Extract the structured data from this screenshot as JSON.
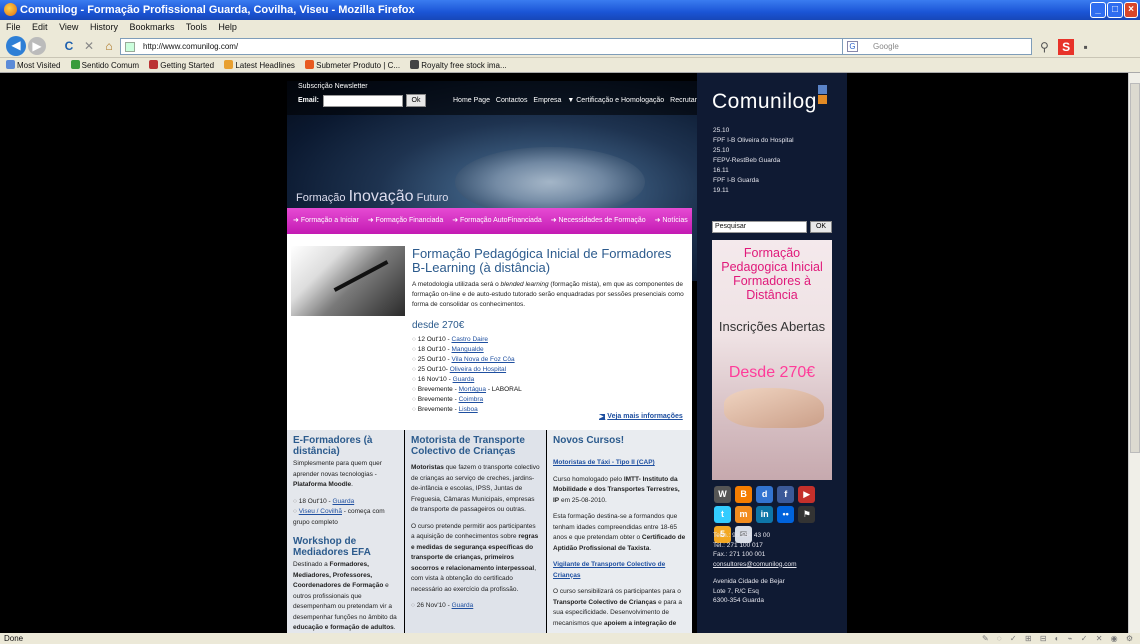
{
  "browser": {
    "title": "Comunilog - Formação Profissional Guarda, Covilha, Viseu - Mozilla Firefox",
    "menu": [
      "File",
      "Edit",
      "View",
      "History",
      "Bookmarks",
      "Tools",
      "Help"
    ],
    "url": "http://www.comunilog.com/",
    "search_placeholder": "Google",
    "bookmarks": [
      "Most Visited",
      "Sentido Comum",
      "Getting Started",
      "Latest Headlines",
      "Submeter Produto | C...",
      "Royalty free stock ima..."
    ],
    "status": "Done"
  },
  "header": {
    "newsletter_label": "Subscrição Newsletter",
    "email_label": "Email:",
    "ok_label": "Ok",
    "nav": [
      "Home Page",
      "Contactos",
      "Empresa",
      "▼ Certificação e Homologação",
      "Recrutamento"
    ],
    "tagline_pre": "Formação",
    "tagline_big": "Inovação",
    "tagline_post": "Futuro"
  },
  "subnav": [
    "Formação a Iniciar",
    "Formação Financiada",
    "Formação AutoFinanciada",
    "Necessidades de Formação",
    "Notícias"
  ],
  "feature": {
    "title": "Formação Pedagógica Inicial de Formadores B-Learning (à distância)",
    "intro_pre": "A metodologia utilizada será o ",
    "intro_em": "blended learning",
    "intro_post": " (formação mista), em que as componentes de formação on-line e de auto-estudo tutorado serão enquadradas por sessões presenciais como forma de consolidar os conhecimentos.",
    "price": "desde 270€",
    "dates": [
      {
        "text": "12 Out'10 - ",
        "link": "Castro Daire",
        "tail": ""
      },
      {
        "text": "18 Out'10 - ",
        "link": "Mangualde",
        "tail": ""
      },
      {
        "text": "25 Out'10 - ",
        "link": "Vila Nova de Foz Côa",
        "tail": ""
      },
      {
        "text": "25 Out'10- ",
        "link": "Oliveira do Hospital",
        "tail": ""
      },
      {
        "text": "16 Nov'10 - ",
        "link": "Guarda",
        "tail": ""
      },
      {
        "text": "Brevemente - ",
        "link": "Mortágua",
        "tail": " - LABORAL"
      },
      {
        "text": "Brevemente - ",
        "link": "Coimbra",
        "tail": ""
      },
      {
        "text": "Brevemente - ",
        "link": "Lisboa",
        "tail": ""
      }
    ],
    "more": "Veja mais informações"
  },
  "col1": {
    "title": "E-Formadores (à distância)",
    "text_pre": "Simplesmente para quem quer aprender novas tecnologias - ",
    "text_bold": "Plataforma Moodle",
    "text_post": ".",
    "items": [
      {
        "text": "18 Out'10 - ",
        "link": "Guarda",
        "tail": ""
      },
      {
        "text": "",
        "link": "Viseu / Covilhã",
        "tail": " - começa com grupo completo"
      }
    ],
    "title2": "Workshop de Mediadores EFA",
    "text2_pre": "Destinado a ",
    "text2_bold": "Formadores, Mediadores, Professores, Coordenadores de Formação",
    "text2_mid": " e outros profissionais que desempenham ou pretendam vir a desempenhar funções no âmbito da ",
    "text2_bold2": "educação e formação de adultos",
    "text2_post": "."
  },
  "col2": {
    "title": "Motorista de Transporte Colectivo de Crianças",
    "p1_bold": "Motoristas",
    "p1": " que fazem o transporte colectivo de crianças ao serviço de creches, jardins-de-infância e escolas, IPSS, Juntas de Freguesia, Câmaras Municipais, empresas de transporte de passageiros ou outras.",
    "p2_pre": "O curso pretende permitir aos participantes a aquisição de conhecimentos sobre ",
    "p2_bold": "regras e medidas de segurança específicas do transporte de crianças, primeiros socorros e relacionamento interpessoal",
    "p2_post": ", com vista à obtenção do certificado necessário ao exercício da profissão.",
    "item": {
      "text": "26 Nov'10 - ",
      "link": "Guarda"
    }
  },
  "col3": {
    "title": "Novos Cursos!",
    "link1": "Motoristas de Táxi - Tipo II (CAP)",
    "p1_pre": "Curso homologado pelo ",
    "p1_bold": "IMTT- Instituto da Mobilidade e dos Transportes Terrestres, IP",
    "p1_post": " em 25-08-2010.",
    "p2_pre": "Esta formação destina-se a formandos que tenham idades compreendidas entre 18-65 anos e que pretendam obter o ",
    "p2_bold": "Certificado de Aptidão Profissional de Taxista",
    "p2_post": ".",
    "link2": "Vigilante de Transporte Colectivo de Crianças",
    "p3_pre": "O curso sensibilizará os participantes para o ",
    "p3_bold": "Transporte Colectivo de Crianças",
    "p3_mid": " e para a sua especificidade. Desenvolvimento de mecanismos que ",
    "p3_bold2": "apoiem a integração de"
  },
  "sidebar": {
    "logo": "Comunilog",
    "news": [
      "25.10",
      "FPF I-B Oliveira do Hospital",
      "25.10",
      "FEPV-RestBeb Guarda",
      "16.11",
      "FPF I-B Guarda",
      "19.11"
    ],
    "search_placeholder": "Pesquisar",
    "search_ok": "OK",
    "ad_title": "Formação Pedagogica Inicial Formadores à Distância",
    "ad_mid": "Inscrições Abertas",
    "ad_price": "Desde 270€",
    "social_icons": [
      "wordpress-icon",
      "blogger-icon",
      "delicious-icon",
      "facebook-icon",
      "youtube-icon",
      "twitter-icon",
      "myspace-icon",
      "linkedin-icon",
      "flickr-icon",
      "digg-icon",
      "hi5-icon",
      "mail-icon"
    ],
    "phone": "Telm.: 96 154 43 00",
    "tel": "Tel.: 271 100 017",
    "fax": "Fax.: 271 100 001",
    "email": "consultores@comunilog.com",
    "addr1": "Avenida Cidade de Bejar",
    "addr2": "Lote 7, R/C Esq",
    "addr3": "6300-354 Guarda"
  },
  "colors": {
    "magenta": "#d22bc4",
    "blue_heading": "#2c5b8d",
    "sidebar_bg": "#0f1a33"
  }
}
